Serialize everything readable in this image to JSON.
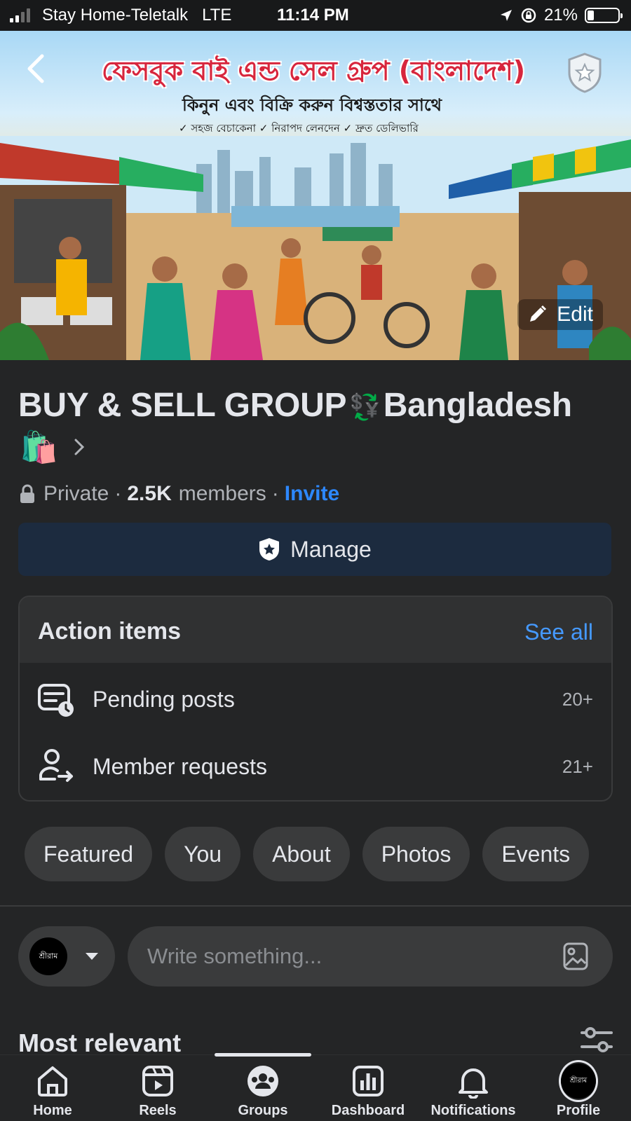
{
  "status_bar": {
    "carrier": "Stay Home-Teletalk",
    "network": "LTE",
    "time": "11:14 PM",
    "battery": "21%",
    "battery_level": 0.21
  },
  "cover": {
    "banner_title": "ফেসবুক বাই এন্ড সেল গ্রুপ (বাংলাদেশ)",
    "banner_subtitle": "কিনুন এবং বিক্রি করুন বিশ্বস্ততার সাথে",
    "banner_tags": "✓ সহজ বেচাকেনা  ✓ নিরাপদ লেনদেন  ✓ দ্রুত ডেলিভারি",
    "edit_label": "Edit"
  },
  "group": {
    "name_part1": "BUY & SELL GROUP",
    "name_separator": "💱",
    "name_part2": "Bangladesh",
    "name_emoji": "🛍️",
    "privacy": "Private",
    "member_count": "2.5K",
    "members_label": "members",
    "invite_label": "Invite"
  },
  "manage": {
    "label": "Manage"
  },
  "action_items": {
    "title": "Action items",
    "see_all": "See all",
    "rows": [
      {
        "label": "Pending posts",
        "count": "20+",
        "icon": "pending-posts-icon"
      },
      {
        "label": "Member requests",
        "count": "21+",
        "icon": "member-requests-icon"
      }
    ]
  },
  "tabs": [
    "Featured",
    "You",
    "About",
    "Photos",
    "Events"
  ],
  "composer": {
    "avatar_text": "শ্রীরাম",
    "placeholder": "Write something..."
  },
  "feed": {
    "sort_label": "Most relevant"
  },
  "bottom_nav": {
    "items": [
      {
        "label": "Home",
        "icon": "home-icon"
      },
      {
        "label": "Reels",
        "icon": "reels-icon"
      },
      {
        "label": "Groups",
        "icon": "groups-icon",
        "active": true
      },
      {
        "label": "Dashboard",
        "icon": "dashboard-icon"
      },
      {
        "label": "Notifications",
        "icon": "bell-icon"
      },
      {
        "label": "Profile",
        "icon": "profile-avatar"
      }
    ]
  },
  "colors": {
    "background": "#242526",
    "accent": "#2d88ff",
    "manage_button": "#1c2b3f",
    "see_all": "#4599ff"
  }
}
